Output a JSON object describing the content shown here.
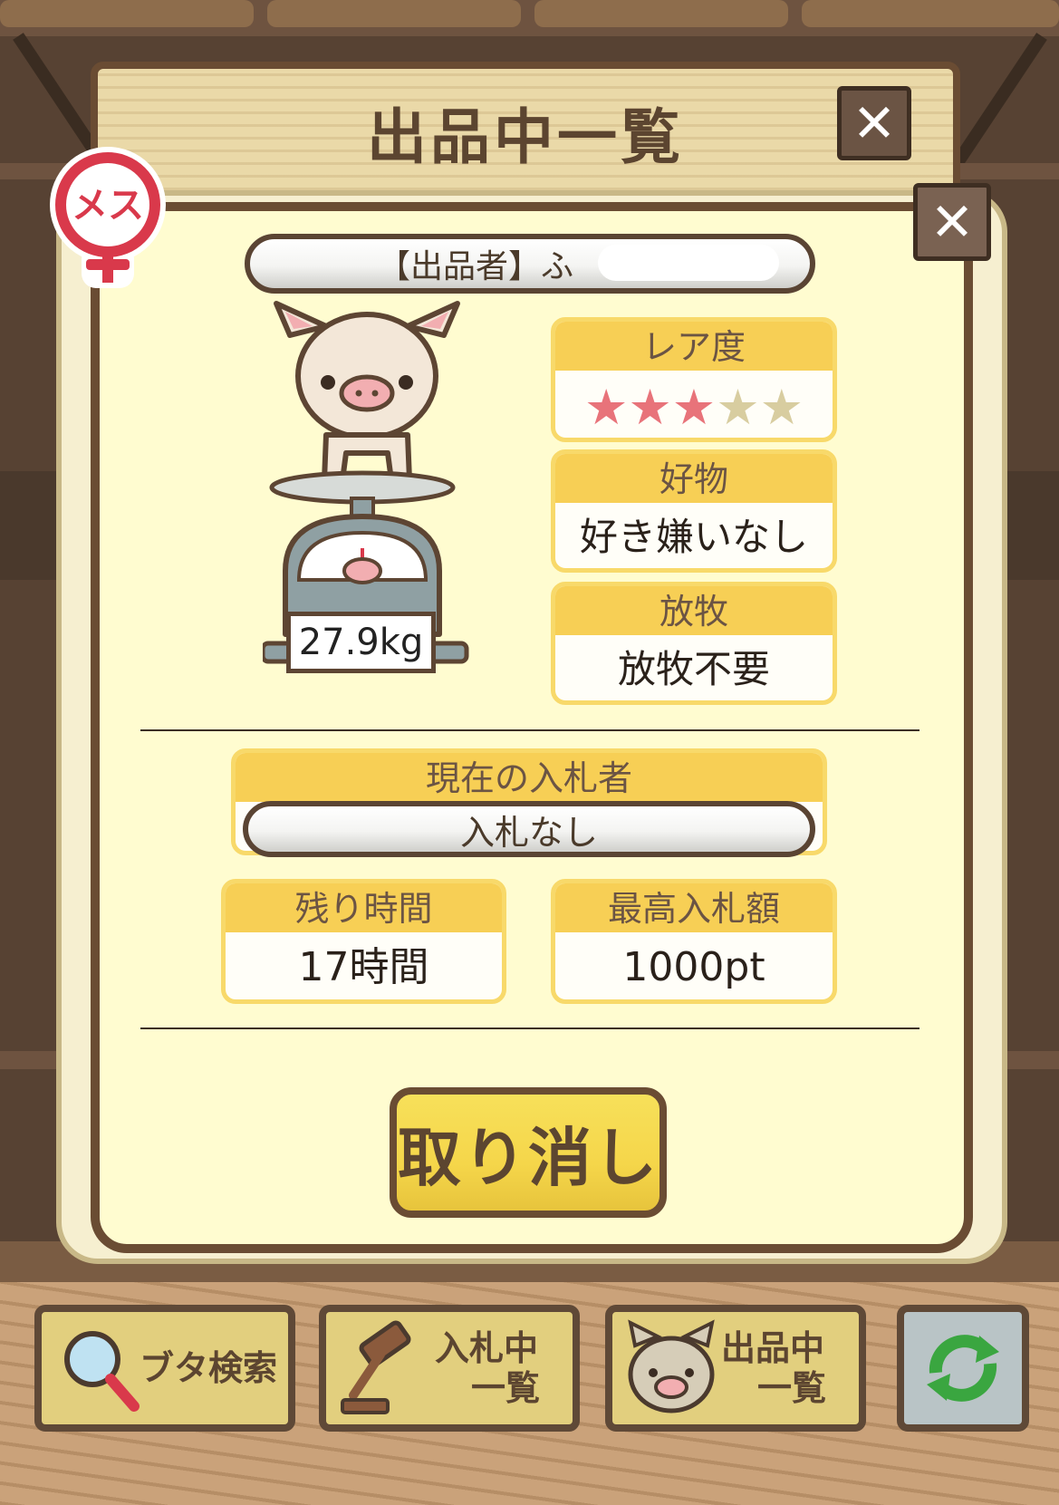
{
  "header": {
    "title": "出品中一覧",
    "close_glyph": "✕"
  },
  "dialog": {
    "close_glyph": "✕",
    "gender_badge": "メス",
    "seller_label": "【出品者】ふ",
    "weight": "27.9kg",
    "rarity": {
      "label": "レア度",
      "value": 3,
      "max": 5,
      "filled_color": "#e8737a",
      "empty_color": "#d8cda0"
    },
    "favorite": {
      "label": "好物",
      "value": "好き嫌いなし"
    },
    "grazing": {
      "label": "放牧",
      "value": "放牧不要"
    },
    "bidder": {
      "label": "現在の入札者",
      "value": "入札なし"
    },
    "time_left": {
      "label": "残り時間",
      "value": "17時間"
    },
    "max_bid": {
      "label": "最高入札額",
      "value": "1000pt"
    },
    "cancel_label": "取り消し"
  },
  "bottom_nav": {
    "search_label": "ブタ検索",
    "bidding_label_1": "入札中",
    "bidding_label_2": "一覧",
    "listing_label_1": "出品中",
    "listing_label_2": "一覧",
    "refresh_icon": "refresh-icon"
  }
}
